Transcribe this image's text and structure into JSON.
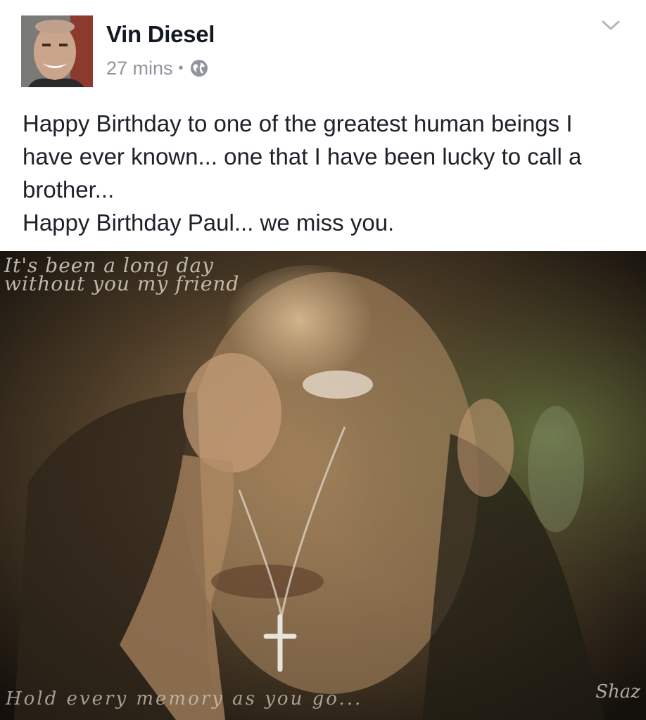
{
  "post": {
    "author": "Vin Diesel",
    "time": "27 mins",
    "separator": "•",
    "privacy_icon": "globe-icon",
    "menu_icon": "chevron-down-icon",
    "text_lines": [
      "Happy Birthday to one of the greatest human beings I have ever known... one that I have been lucky to call a brother...",
      "Happy Birthday Paul... we miss you."
    ]
  },
  "photo": {
    "caption_top": [
      "It's been a long day",
      "without you my friend"
    ],
    "caption_bottom": "Hold every memory as you go...",
    "signature": "Shaz"
  },
  "colors": {
    "author": "#141823",
    "meta": "#90949c",
    "text": "#1d2129"
  }
}
